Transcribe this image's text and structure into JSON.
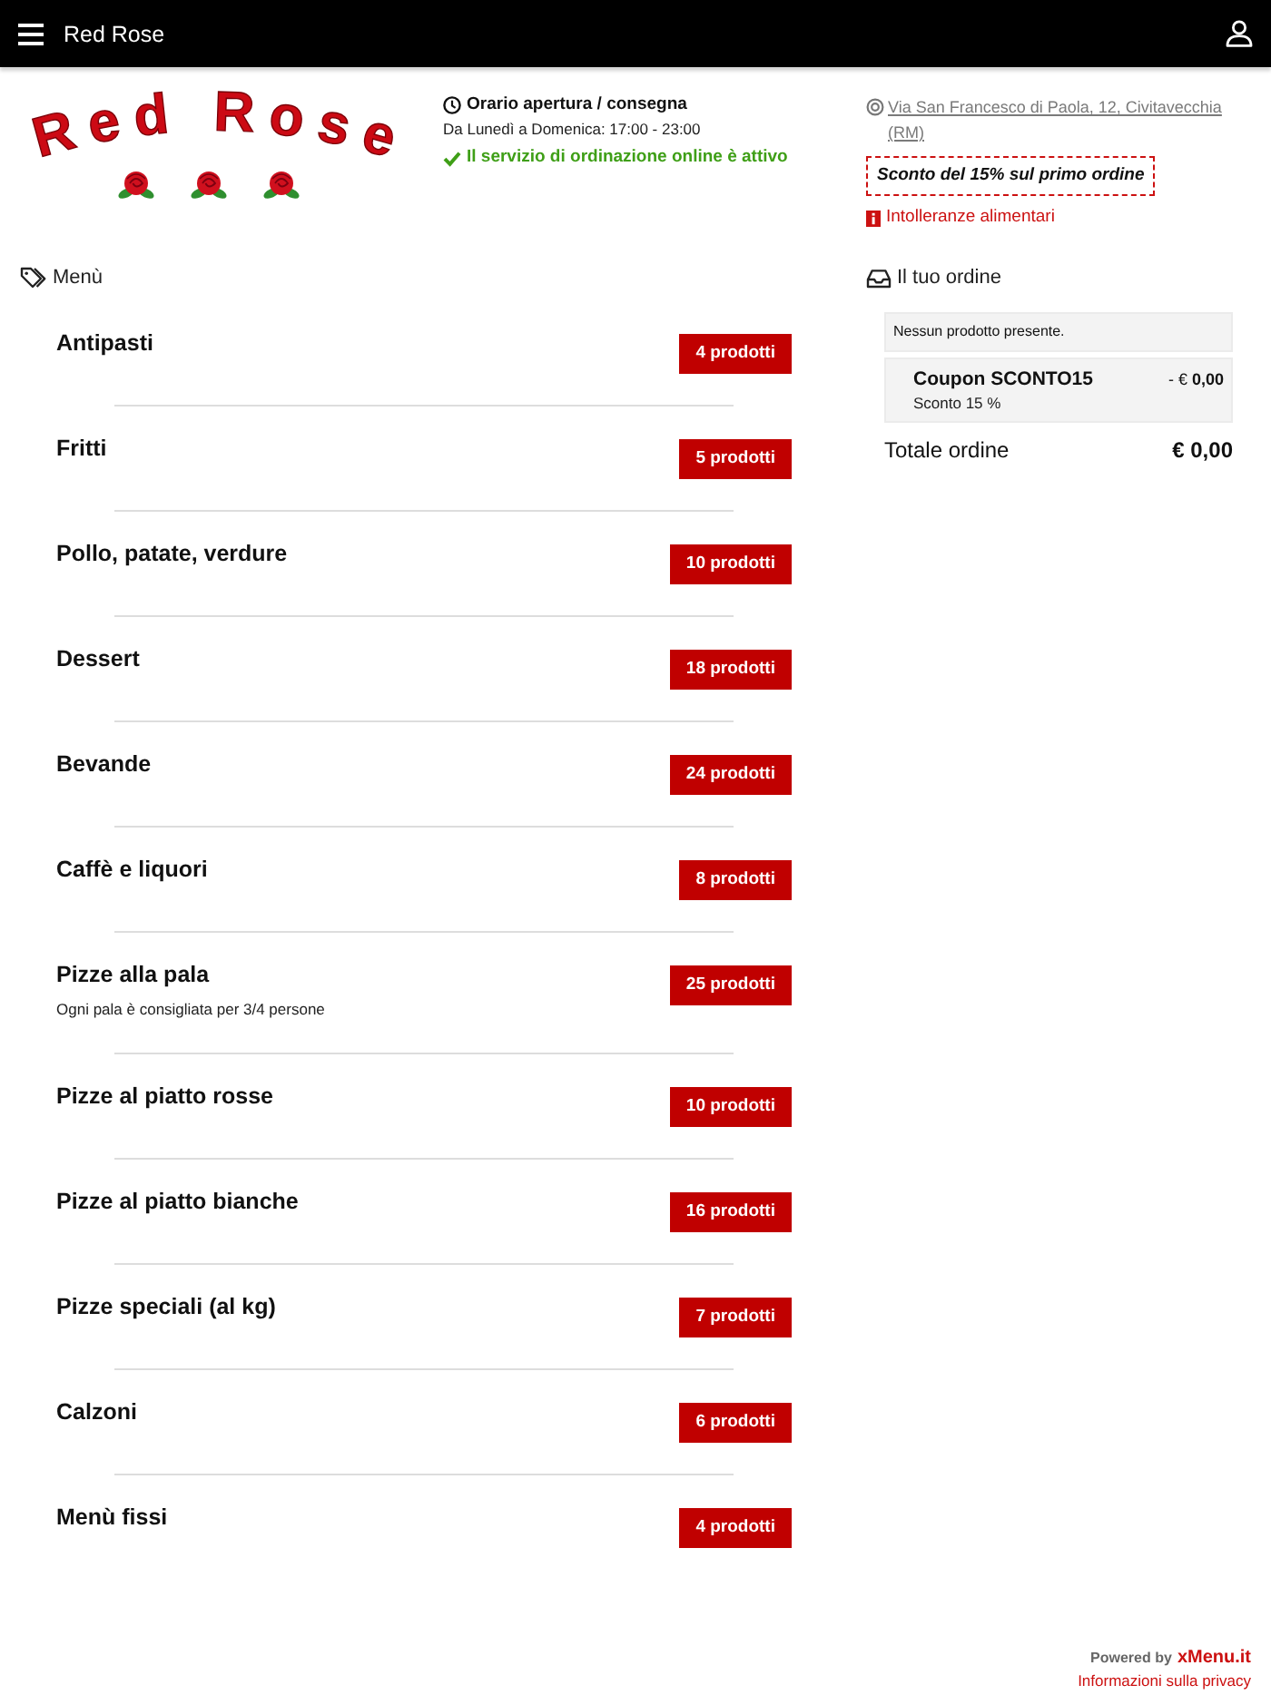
{
  "header": {
    "title": "Red Rose"
  },
  "logo": {
    "text": "Red Rose"
  },
  "hours": {
    "title": "Orario apertura / consegna",
    "schedule": "Da Lunedì a Domenica: 17:00 - 23:00",
    "status": "Il servizio di ordinazione online è attivo"
  },
  "info": {
    "address": "Via San Francesco di Paola, 12, Civitavecchia (RM)",
    "promo": "Sconto del 15% sul primo ordine",
    "allergens_link": "Intolleranze alimentari"
  },
  "menu": {
    "title": "Menù",
    "categories": [
      {
        "name": "Antipasti",
        "count": "4 prodotti"
      },
      {
        "name": "Fritti",
        "count": "5 prodotti"
      },
      {
        "name": "Pollo, patate, verdure",
        "count": "10 prodotti"
      },
      {
        "name": "Dessert",
        "count": "18 prodotti"
      },
      {
        "name": "Bevande",
        "count": "24 prodotti"
      },
      {
        "name": "Caffè e liquori",
        "count": "8 prodotti"
      },
      {
        "name": "Pizze alla pala",
        "description": "Ogni pala è consigliata per 3/4 persone",
        "count": "25 prodotti"
      },
      {
        "name": "Pizze al piatto rosse",
        "count": "10 prodotti"
      },
      {
        "name": "Pizze al piatto bianche",
        "count": "16 prodotti"
      },
      {
        "name": "Pizze speciali (al kg)",
        "count": "7 prodotti"
      },
      {
        "name": "Calzoni",
        "count": "6 prodotti"
      },
      {
        "name": "Menù fissi",
        "count": "4 prodotti"
      }
    ]
  },
  "order": {
    "title": "Il tuo ordine",
    "empty_message": "Nessun prodotto presente.",
    "coupon": {
      "name": "Coupon SCONTO15",
      "note": "Sconto 15 %",
      "amount": "- € **0,00**"
    },
    "total_label": "Totale ordine",
    "total": "€ 0,00"
  },
  "footer": {
    "powered_by": "Powered by",
    "brand": "xMenu.it",
    "privacy_link": "Informazioni sulla privacy"
  }
}
